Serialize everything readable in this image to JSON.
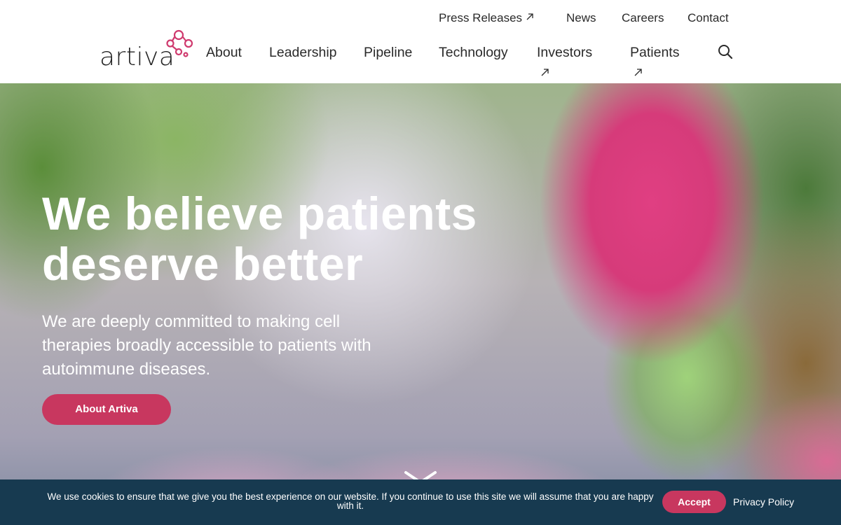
{
  "brand": {
    "name": "artiva",
    "colors": {
      "accent": "#c8375f",
      "logo_mark": "#cf3a6e",
      "text": "#2a2a2a",
      "cookie_bar": "#173a50"
    }
  },
  "top_nav": {
    "items": [
      {
        "label": "Press Releases",
        "icon": "external-link-icon"
      },
      {
        "label": "News"
      },
      {
        "label": "Careers"
      },
      {
        "label": "Contact"
      }
    ]
  },
  "main_nav": {
    "items": [
      {
        "label": "About"
      },
      {
        "label": "Leadership"
      },
      {
        "label": "Pipeline"
      },
      {
        "label": "Technology"
      },
      {
        "label": "Investors",
        "icon": "external-link-icon"
      },
      {
        "label": "Patients",
        "icon": "external-link-icon"
      }
    ],
    "search_icon": "search-icon"
  },
  "hero": {
    "headline_line1": "We believe patients",
    "headline_line2": "deserve better",
    "subtext": "We are deeply committed to making cell therapies broadly accessible to patients with autoimmune diseases.",
    "cta_label": "About Artiva",
    "scroll_icon": "chevron-down-icon"
  },
  "cookie_banner": {
    "message": "We use cookies to ensure that we give you the best experience on our website. If you continue to use this site we will assume that you are happy with it.",
    "accept_label": "Accept",
    "privacy_label": "Privacy Policy"
  }
}
